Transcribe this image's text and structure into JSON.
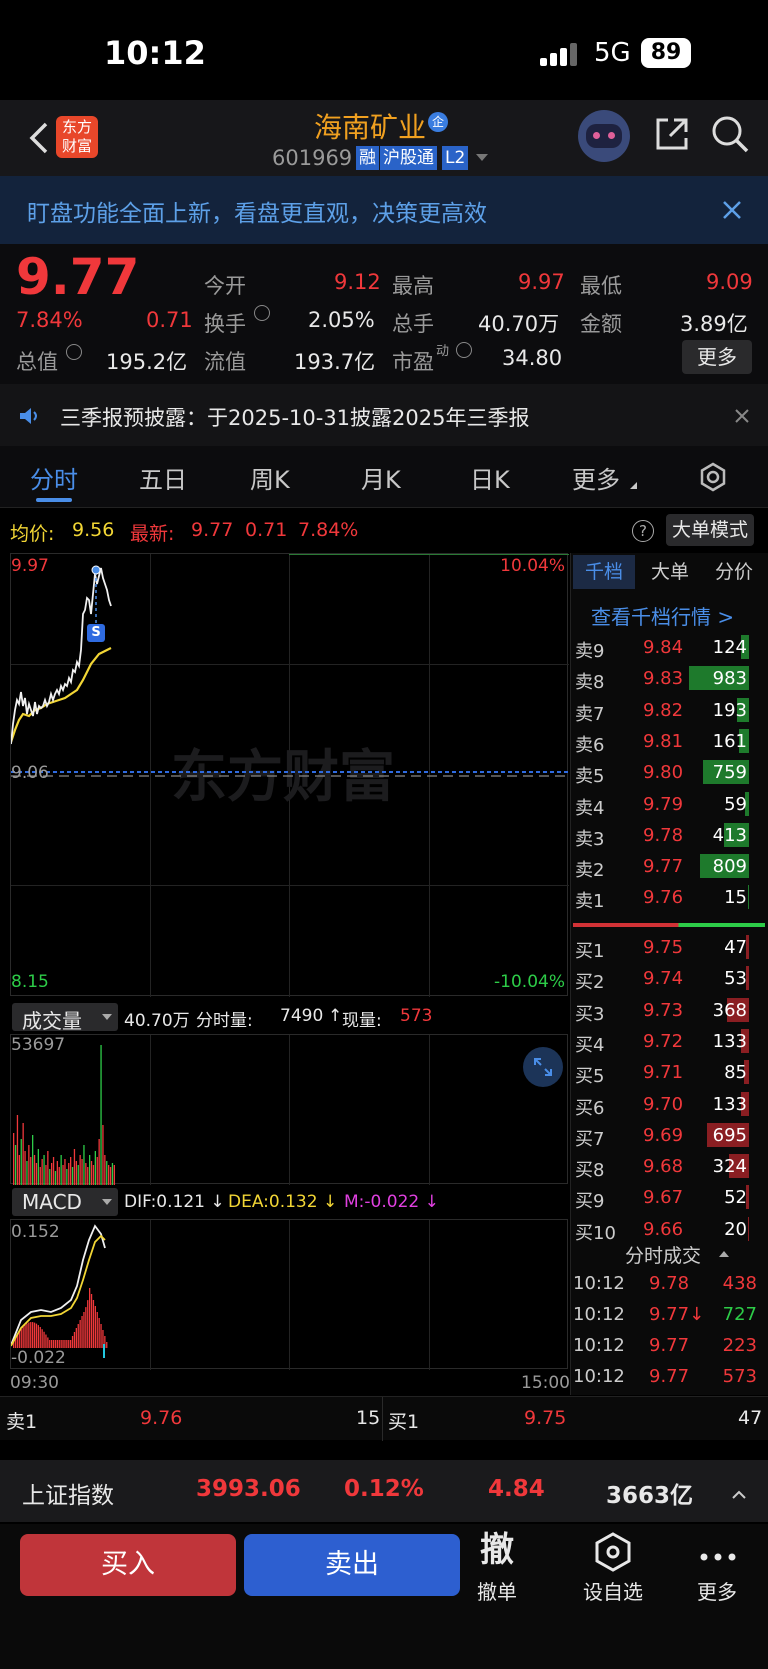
{
  "status": {
    "time": "10:12",
    "network": "5G",
    "battery": "89"
  },
  "header": {
    "title": "海南矿业",
    "title_badge": "企",
    "code": "601969",
    "tags": [
      "融",
      "沪股通",
      "L2"
    ],
    "logo_line1": "东方",
    "logo_line2": "财富"
  },
  "banner": {
    "text": "盯盘功能全面上新，看盘更直观，决策更高效"
  },
  "quote": {
    "price": "9.77",
    "change_pct": "7.84%",
    "change": "0.71",
    "open_label": "今开",
    "open": "9.12",
    "high_label": "最高",
    "high": "9.97",
    "low_label": "最低",
    "low": "9.09",
    "turnover_label": "换手",
    "turnover": "2.05%",
    "volume_label": "总手",
    "volume": "40.70万",
    "amount_label": "金额",
    "amount": "3.89亿",
    "mktcap_label": "总值",
    "mktcap": "195.2亿",
    "float_label": "流值",
    "float": "193.7亿",
    "pe_label": "市盈",
    "pe_sup": "动",
    "pe": "34.80",
    "more": "更多"
  },
  "notice": {
    "text": "三季报预披露：于2025-10-31披露2025年三季报"
  },
  "tabs": [
    "分时",
    "五日",
    "周K",
    "月K",
    "日K",
    "更多"
  ],
  "info": {
    "avg_label": "均价:",
    "avg": "9.56",
    "latest_label": "最新:",
    "latest": "9.77",
    "chg": "0.71",
    "pct": "7.84%",
    "mode": "大单模式"
  },
  "price_chart": {
    "top": "9.97",
    "mid": "9.06",
    "bottom": "8.15",
    "pct_top": "10.04%",
    "pct_bottom": "-10.04%",
    "watermark": "东方财富",
    "marker": "S"
  },
  "vol_panel": {
    "selector": "成交量",
    "total": "40.70万",
    "interval_label": "分时量:",
    "interval": "7490",
    "arrow": "↑",
    "now_label": "现量:",
    "now": "573",
    "max": "53697"
  },
  "macd_panel": {
    "selector": "MACD",
    "dif": "DIF:0.121 ↓",
    "dea": "DEA:0.132 ↓",
    "m": "M:-0.022 ↓",
    "top": "0.152",
    "bottom": "-0.022",
    "time_start": "09:30",
    "time_end": "15:00"
  },
  "orderbook": {
    "tabs": [
      "千档",
      "大单",
      "分价"
    ],
    "link": "查看千档行情 >",
    "asks": [
      {
        "label": "卖9",
        "price": "9.84",
        "vol": "124"
      },
      {
        "label": "卖8",
        "price": "9.83",
        "vol": "983"
      },
      {
        "label": "卖7",
        "price": "9.82",
        "vol": "193"
      },
      {
        "label": "卖6",
        "price": "9.81",
        "vol": "161"
      },
      {
        "label": "卖5",
        "price": "9.80",
        "vol": "759"
      },
      {
        "label": "卖4",
        "price": "9.79",
        "vol": "59"
      },
      {
        "label": "卖3",
        "price": "9.78",
        "vol": "413"
      },
      {
        "label": "卖2",
        "price": "9.77",
        "vol": "809"
      },
      {
        "label": "卖1",
        "price": "9.76",
        "vol": "15"
      }
    ],
    "bids": [
      {
        "label": "买1",
        "price": "9.75",
        "vol": "47"
      },
      {
        "label": "买2",
        "price": "9.74",
        "vol": "53"
      },
      {
        "label": "买3",
        "price": "9.73",
        "vol": "368"
      },
      {
        "label": "买4",
        "price": "9.72",
        "vol": "133"
      },
      {
        "label": "买5",
        "price": "9.71",
        "vol": "85"
      },
      {
        "label": "买6",
        "price": "9.70",
        "vol": "133"
      },
      {
        "label": "买7",
        "price": "9.69",
        "vol": "695"
      },
      {
        "label": "买8",
        "price": "9.68",
        "vol": "324"
      },
      {
        "label": "买9",
        "price": "9.67",
        "vol": "52"
      },
      {
        "label": "买10",
        "price": "9.66",
        "vol": "20"
      }
    ]
  },
  "trades": {
    "title": "分时成交",
    "rows": [
      {
        "time": "10:12",
        "price": "9.78",
        "vol": "438"
      },
      {
        "time": "10:12",
        "price": "9.77↓",
        "vol": "727"
      },
      {
        "time": "10:12",
        "price": "9.77",
        "vol": "223"
      },
      {
        "time": "10:12",
        "price": "9.77",
        "vol": "573"
      }
    ]
  },
  "level1": {
    "ask_label": "卖1",
    "ask_price": "9.76",
    "ask_vol": "15",
    "bid_label": "买1",
    "bid_price": "9.75",
    "bid_vol": "47"
  },
  "index": {
    "name": "上证指数",
    "value": "3993.06",
    "pct": "0.12%",
    "chg": "4.84",
    "amount": "3663亿"
  },
  "actions": {
    "buy": "买入",
    "sell": "卖出",
    "cancel_glyph": "撤",
    "cancel": "撤单",
    "watch": "设自选",
    "more": "更多"
  },
  "colors": {
    "up": "#f0383b",
    "down": "#2dcc48",
    "brand": "#f0a020",
    "buy_btn": "#c0353a",
    "sell_btn": "#2d5fd0"
  }
}
